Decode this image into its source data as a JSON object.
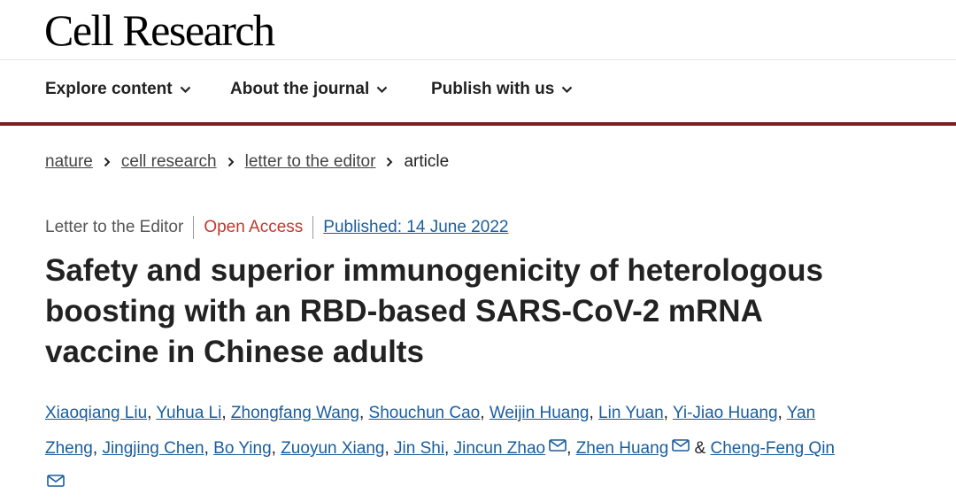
{
  "site": {
    "logo": "Cell Research"
  },
  "nav": {
    "items": [
      {
        "label": "Explore content",
        "icon": "chevron-down-icon"
      },
      {
        "label": "About the journal",
        "icon": "chevron-down-icon"
      },
      {
        "label": "Publish with us",
        "icon": "chevron-down-icon"
      }
    ],
    "border_color": "#7a1e22"
  },
  "breadcrumb": {
    "items": [
      "nature",
      "cell research",
      "letter to the editor"
    ],
    "current": "article",
    "separator_icon": "chevron-right-icon"
  },
  "article": {
    "type": "Letter to the Editor",
    "access": "Open Access",
    "published": "Published: 14 June 2022",
    "title_lines": [
      "Safety and superior immunogenicity of heterologous",
      "boosting with an RBD-based SARS-CoV-2 mRNA",
      "vaccine in Chinese adults"
    ],
    "authors_line1": [
      "Xiaoqiang Liu",
      "Yuhua Li",
      "Zhongfang Wang",
      "Shouchun Cao",
      "Weijin Huang",
      "Lin Yuan",
      "Yi-Jiao Huang",
      "Yan"
    ],
    "authors_line2_a": [
      "Zheng",
      "Jingjing Chen",
      "Bo Ying",
      "Zuoyun Xiang",
      "Jin Shi"
    ],
    "corresponding": [
      "Jincun Zhao",
      "Zhen Huang"
    ],
    "ampersand": "&",
    "last_author": "Cheng-Feng Qin",
    "mail_icon": "mail-icon"
  },
  "colors": {
    "link": "#1a5d9c",
    "open_access": "#c0392b",
    "text": "#222222"
  }
}
